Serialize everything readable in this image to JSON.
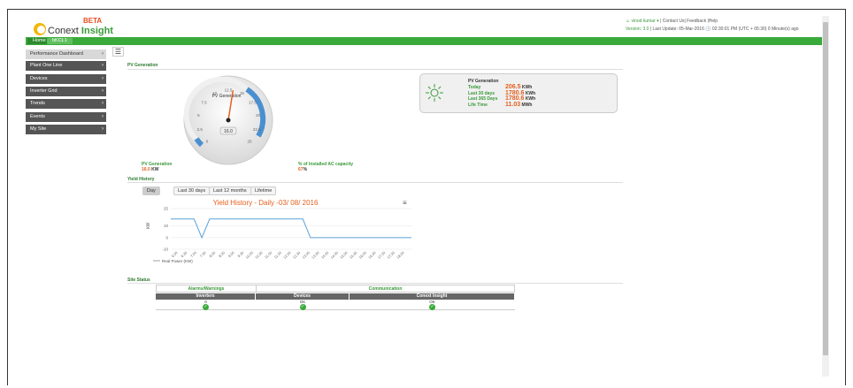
{
  "header": {
    "brand_pre": "Conext ",
    "brand_bold": "Insight",
    "beta": "BETA",
    "user": "vinod kumar ▾",
    "links": "| Contact Us| Feedback |Help",
    "version": "Version: 3.0",
    "update_label": "| Last Update:",
    "update_value": "05-Mar-2016  🕓  02:30:01 PM (UTC + 05:30) 0 Minute(s) ago"
  },
  "breadcrumb": {
    "home": "Home",
    "site": "bKCL1"
  },
  "sidebar": {
    "items": [
      {
        "label": "Performance Dashboard"
      },
      {
        "label": "Plant One Line"
      },
      {
        "label": "Devices"
      },
      {
        "label": "Inverter Grid"
      },
      {
        "label": "Trends"
      },
      {
        "label": "Events"
      },
      {
        "label": "My Site"
      }
    ]
  },
  "pv": {
    "section_title": "PV Generation",
    "gauge_title": "PV Generation",
    "gauge_value": "16.0",
    "gauge_min": 0,
    "gauge_max": 30,
    "gauge_reading": 16.0,
    "ticks": [
      "0",
      "2.5",
      "5",
      "7.5",
      "10",
      "12.5",
      "15",
      "17.5",
      "20",
      "22.5",
      "25"
    ],
    "box_title": "PV Generation",
    "rows": [
      {
        "label": "Today",
        "value": "206.5",
        "unit": "KWh"
      },
      {
        "label": "Last 30 days",
        "value": "1780.6",
        "unit": "KWh"
      },
      {
        "label": "Last 365 Days",
        "value": "1780.6",
        "unit": "KWh"
      },
      {
        "label": "Life Time",
        "value": "11.03",
        "unit": "MWh"
      }
    ],
    "gen_label": "PV Generation",
    "gen_value": "16.0",
    "gen_unit": "KW",
    "cap_label": "% of Installed AC capacity",
    "cap_value": "67",
    "cap_unit": "%"
  },
  "yield": {
    "section_title": "Yield History",
    "tabs": [
      "Day",
      "Last 30 days",
      "Last 12 months",
      "Lifetime"
    ]
  },
  "chart_data": {
    "type": "line",
    "title": "Yield History - Daily -03/ 08/ 2016",
    "ylabel": "kW",
    "ylim": [
      -10,
      25
    ],
    "yticks": [
      "25",
      "10",
      "0",
      "-10"
    ],
    "x": [
      "6.00",
      "6.30",
      "7.00",
      "7.30",
      "8.00",
      "8.30",
      "9.00",
      "9.30",
      "10.00",
      "10.30",
      "11.00",
      "11.30",
      "12.00",
      "12.30",
      "13.00",
      "13.30",
      "14.00",
      "14.30",
      "15.00",
      "15.30",
      "16.00",
      "16.30",
      "17.00",
      "17.30",
      "18.00"
    ],
    "series": [
      {
        "name": "Real Power (KW)",
        "values": [
          16,
          16,
          16,
          16,
          0,
          16,
          16,
          16,
          16,
          16,
          16,
          16,
          16,
          16,
          16,
          16,
          16,
          16,
          0,
          0,
          0,
          0,
          0,
          0,
          0,
          0,
          0,
          0,
          0,
          0,
          0,
          0
        ]
      }
    ],
    "color": "#5aa0d8"
  },
  "status": {
    "section_title": "Site Status",
    "alarms": "Alarms/Warnings",
    "comm": "Communication",
    "cols": [
      "Inverters",
      "Devices",
      "Conext Insight"
    ],
    "vals": [
      "0",
      "OK",
      "OK"
    ]
  }
}
